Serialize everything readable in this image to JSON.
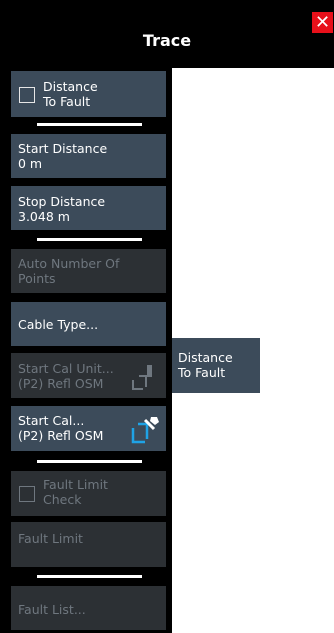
{
  "title": "Trace",
  "close_icon": "close-icon",
  "colors": {
    "accent": "#e8101a",
    "button": "#3c4b5a",
    "disabled_button": "#2c3034",
    "icon_blue": "#1fa3e6"
  },
  "buttons": {
    "distance_to_fault": {
      "line1": "Distance",
      "line2": "To Fault",
      "checked": false
    },
    "start_distance": {
      "label": "Start Distance",
      "value": "0 m"
    },
    "stop_distance": {
      "label": "Stop Distance",
      "value": "3.048 m"
    },
    "auto_number_points": {
      "line1": "Auto Number Of",
      "line2": "Points"
    },
    "cable_type": {
      "label": "Cable Type..."
    },
    "start_cal_unit": {
      "line1": "Start Cal Unit...",
      "line2": "(P2) Refl OSM"
    },
    "start_cal": {
      "line1": "Start Cal...",
      "line2": "(P2) Refl OSM"
    },
    "fault_limit_check": {
      "line1": "Fault Limit",
      "line2": "Check",
      "checked": false
    },
    "fault_limit": {
      "label": "Fault Limit"
    },
    "fault_list": {
      "label": "Fault List..."
    }
  },
  "tooltip": {
    "line1": "Distance",
    "line2": "To Fault"
  }
}
